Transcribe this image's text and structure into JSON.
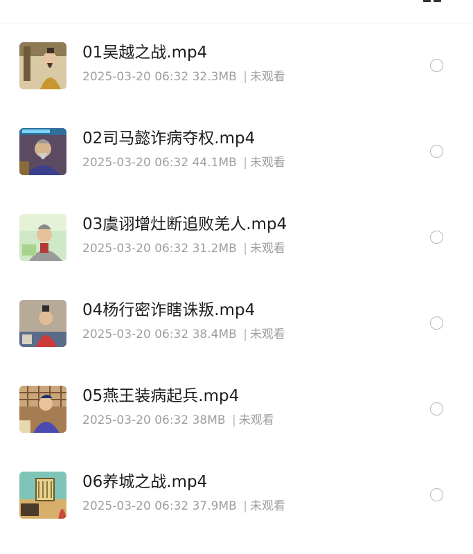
{
  "header": {
    "icon": "grid-icon"
  },
  "files": [
    {
      "title": "01吴越之战.mp4",
      "datetime": "2025-03-20 06:32",
      "size": "32.3MB",
      "sep": "|",
      "status": "未观看"
    },
    {
      "title": "02司马懿诈病夺权.mp4",
      "datetime": "2025-03-20 06:32",
      "size": "44.1MB",
      "sep": "|",
      "status": "未观看"
    },
    {
      "title": "03虞诩增灶断追败羌人.mp4",
      "datetime": "2025-03-20 06:32",
      "size": "31.2MB",
      "sep": "|",
      "status": "未观看"
    },
    {
      "title": "04杨行密诈瞎诛叛.mp4",
      "datetime": "2025-03-20 06:32",
      "size": "38.4MB",
      "sep": "|",
      "status": "未观看"
    },
    {
      "title": "05燕王装病起兵.mp4",
      "datetime": "2025-03-20 06:32",
      "size": "38MB",
      "sep": "|",
      "status": "未观看"
    },
    {
      "title": "06养城之战.mp4",
      "datetime": "2025-03-20 06:32",
      "size": "37.9MB",
      "sep": "|",
      "status": "未观看"
    }
  ]
}
